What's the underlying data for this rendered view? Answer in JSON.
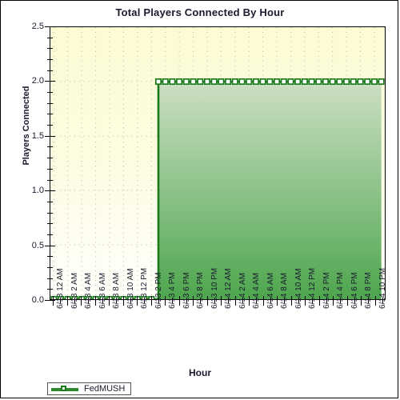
{
  "chart_data": {
    "type": "area",
    "title": "Total Players Connected By Hour",
    "xlabel": "Hour",
    "ylabel": "Players Connected",
    "ylim": [
      0,
      2.5
    ],
    "ytick_labels": [
      "0.0",
      "0.5",
      "1.0",
      "1.5",
      "2.0",
      "2.5"
    ],
    "ytick_values": [
      0,
      0.5,
      1,
      1.5,
      2,
      2.5
    ],
    "minor_ticks_per_interval": 5,
    "grid": true,
    "grid_style": "dotted",
    "legend_position": "bottom-left",
    "marker": "square-open",
    "series": [
      {
        "name": "FedMUSH",
        "color": "#1a7a1a",
        "fill_top": "#ccdfc4",
        "fill_bottom": "#4ea64e",
        "values": [
          0,
          0,
          0,
          0,
          0,
          0,
          0,
          0,
          0,
          0,
          0,
          0,
          0,
          0,
          0,
          2,
          2,
          2,
          2,
          2,
          2,
          2,
          2,
          2,
          2,
          2,
          2,
          2,
          2,
          2,
          2,
          2,
          2,
          2,
          2,
          2,
          2,
          2,
          2,
          2,
          2,
          2,
          2,
          2,
          2,
          2,
          2,
          2
        ]
      }
    ],
    "x": [
      "6/13 12 AM",
      "6/13 1 AM",
      "6/13 2 AM",
      "6/13 3 AM",
      "6/13 4 AM",
      "6/13 5 AM",
      "6/13 6 AM",
      "6/13 7 AM",
      "6/13 8 AM",
      "6/13 9 AM",
      "6/13 10 AM",
      "6/13 11 AM",
      "6/13 12 PM",
      "6/13 1 PM",
      "6/13 2 PM",
      "6/13 3 PM",
      "6/13 4 PM",
      "6/13 5 PM",
      "6/13 6 PM",
      "6/13 7 PM",
      "6/13 8 PM",
      "6/13 9 PM",
      "6/13 10 PM",
      "6/13 11 PM",
      "6/14 12 AM",
      "6/14 1 AM",
      "6/14 2 AM",
      "6/14 3 AM",
      "6/14 4 AM",
      "6/14 5 AM",
      "6/14 6 AM",
      "6/14 7 AM",
      "6/14 8 AM",
      "6/14 9 AM",
      "6/14 10 AM",
      "6/14 11 AM",
      "6/14 12 PM",
      "6/14 1 PM",
      "6/14 2 PM",
      "6/14 3 PM",
      "6/14 4 PM",
      "6/14 5 PM",
      "6/14 6 PM",
      "6/14 7 PM",
      "6/14 8 PM",
      "6/14 9 PM",
      "6/14 10 PM",
      "6/14 11 PM"
    ],
    "xtick_labels": [
      "6/13 12 AM",
      "6/13 2 AM",
      "6/13 4 AM",
      "6/13 6 AM",
      "6/13 8 AM",
      "6/13 10 AM",
      "6/13 12 PM",
      "6/13 2 PM",
      "6/13 4 PM",
      "6/13 6 PM",
      "6/13 8 PM",
      "6/13 10 PM",
      "6/14 12 AM",
      "6/14 2 AM",
      "6/14 4 AM",
      "6/14 6 AM",
      "6/14 8 AM",
      "6/14 10 AM",
      "6/14 12 PM",
      "6/14 2 PM",
      "6/14 4 PM",
      "6/14 6 PM",
      "6/14 8 PM",
      "6/14 10 PM"
    ],
    "xtick_indices": [
      0,
      2,
      4,
      6,
      8,
      10,
      12,
      14,
      16,
      18,
      20,
      22,
      24,
      26,
      28,
      30,
      32,
      34,
      36,
      38,
      40,
      42,
      44,
      46
    ]
  }
}
